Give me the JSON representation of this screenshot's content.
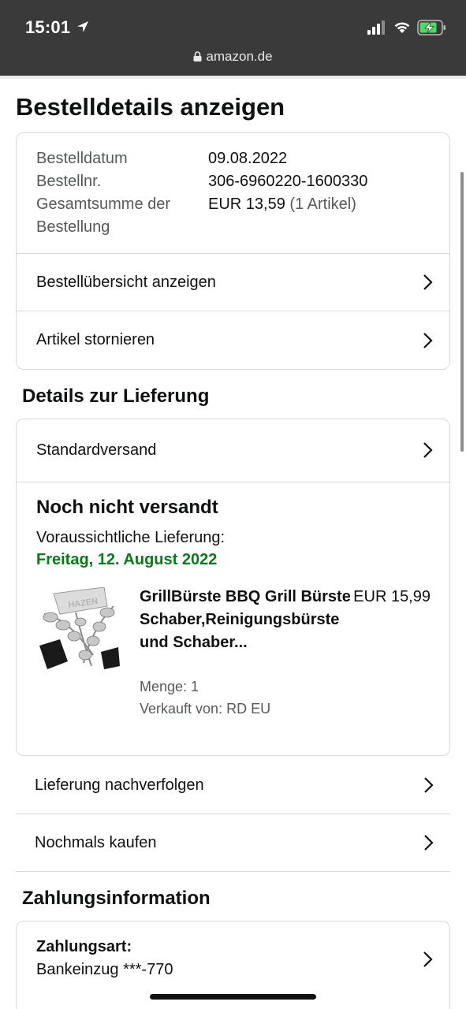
{
  "status_bar": {
    "time": "15:01"
  },
  "url_bar": {
    "domain": "amazon.de"
  },
  "page_title": "Bestelldetails anzeigen",
  "summary": {
    "order_date_label": "Bestelldatum",
    "order_date_value": "09.08.2022",
    "order_number_label": "Bestellnr.",
    "order_number_value": "306-6960220-1600330",
    "total_label_line1": "Gesamtsumme der",
    "total_label_line2": "Bestellung",
    "total_value": "EUR 13,59",
    "total_items": "(1 Artikel)",
    "view_invoice": "Bestellübersicht anzeigen",
    "cancel_items": "Artikel stornieren"
  },
  "delivery": {
    "section_title": "Details zur Lieferung",
    "shipping_method": "Standardversand",
    "status": "Noch nicht versandt",
    "eta_label": "Voraussichtliche Lieferung:",
    "eta_date": "Freitag, 12. August 2022",
    "product": {
      "title": "GrillBürste BBQ Grill Bürste Schaber,Reinigungsbürste und Schaber...",
      "price": "EUR 15,99",
      "quantity": "Menge: 1",
      "seller": "Verkauft von: RD EU",
      "image_brand_text": "HAZEN"
    }
  },
  "actions": {
    "track": "Lieferung nachverfolgen",
    "buy_again": "Nochmals kaufen"
  },
  "payment": {
    "section_title": "Zahlungsinformation",
    "method_label": "Zahlungsart:",
    "method_value": "Bankeinzug ***-770"
  },
  "colors": {
    "status_bar_bg": "#3a3a3a",
    "delivery_date_green": "#067d14",
    "border": "#d5d9d9",
    "battery_green": "#4cd964"
  }
}
